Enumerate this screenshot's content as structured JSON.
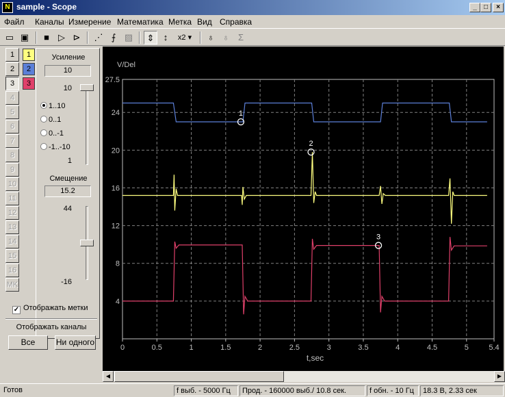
{
  "window": {
    "title": "sample - Scope",
    "min": "_",
    "max": "□",
    "close": "×"
  },
  "menu": [
    "Файл",
    "Каналы",
    "Измерение",
    "Математика",
    "Метка",
    "Вид",
    "Справка"
  ],
  "channels": {
    "buttons": [
      "1",
      "2",
      "3",
      "4",
      "5",
      "6",
      "7",
      "8",
      "9",
      "10",
      "11",
      "12",
      "13",
      "14",
      "15",
      "16",
      "MK"
    ],
    "swatches": [
      {
        "label": "1",
        "color": "#ffff80"
      },
      {
        "label": "2",
        "color": "#5b7fd8"
      },
      {
        "label": "3",
        "color": "#e0406a"
      }
    ]
  },
  "gain": {
    "label": "Усиление",
    "value": "10",
    "slider_top": "10",
    "slider_bottom": "1",
    "slider_level": 0.0,
    "ranges": [
      "1..10",
      "0..1",
      "0..-1",
      "-1..-10"
    ],
    "selected_range": 0
  },
  "offset": {
    "label": "Смещение",
    "value": "15.2",
    "slider_top": "44",
    "slider_bottom": "-16",
    "slider_level": 0.5
  },
  "show_markers": {
    "label": "Отображать метки",
    "checked": true
  },
  "show_channels": {
    "label": "Отображать каналы",
    "all": "Все",
    "none": "Ни одного"
  },
  "status": {
    "ready": "Готов",
    "sample_rate": "f выб. - 5000 Гц",
    "duration": "Прод. - 160000 выб./ 10.8 сек.",
    "refresh": "f обн. - 10 Гц",
    "cursor": "18.3 В,  2.33 сек"
  },
  "chart_data": {
    "type": "line",
    "ylabel": "V/Del",
    "xlabel": "t,sec",
    "xlim": [
      0,
      5.4
    ],
    "ylim": [
      0,
      27.5
    ],
    "x_ticks": [
      "0",
      "0.5",
      "1",
      "1.5",
      "2",
      "2.5",
      "3",
      "3.5",
      "4",
      "4.5",
      "5",
      "5.4"
    ],
    "y_ticks": [
      "4",
      "8",
      "12",
      "16",
      "20",
      "24",
      "27.5"
    ],
    "grid": true,
    "series": [
      {
        "color": "#5b7fd8",
        "points": [
          [
            0,
            25
          ],
          [
            0.74,
            25
          ],
          [
            0.78,
            23
          ],
          [
            1.75,
            23
          ],
          [
            1.78,
            25
          ],
          [
            2.75,
            25
          ],
          [
            2.78,
            23
          ],
          [
            3.75,
            23
          ],
          [
            3.78,
            25
          ],
          [
            4.75,
            25
          ],
          [
            4.78,
            23
          ],
          [
            5.3,
            23
          ]
        ]
      },
      {
        "color": "#ffff80",
        "points": [
          [
            0,
            15.2
          ],
          [
            0.74,
            15.2
          ],
          [
            0.75,
            17.4
          ],
          [
            0.76,
            13.6
          ],
          [
            0.78,
            15.9
          ],
          [
            0.8,
            15.2
          ],
          [
            1.73,
            15.2
          ],
          [
            1.74,
            14.2
          ],
          [
            1.75,
            16.1
          ],
          [
            1.77,
            14.8
          ],
          [
            1.8,
            15.2
          ],
          [
            2.74,
            15.2
          ],
          [
            2.76,
            19.8
          ],
          [
            2.78,
            14.4
          ],
          [
            2.8,
            15.6
          ],
          [
            2.82,
            15.2
          ],
          [
            3.73,
            15.2
          ],
          [
            3.75,
            16.2
          ],
          [
            3.77,
            14.3
          ],
          [
            3.79,
            15.4
          ],
          [
            3.82,
            15.2
          ],
          [
            4.74,
            15.2
          ],
          [
            4.76,
            17
          ],
          [
            4.78,
            12.2
          ],
          [
            4.8,
            15.6
          ],
          [
            4.82,
            15.2
          ],
          [
            5.3,
            15.2
          ]
        ]
      },
      {
        "color": "#e0406a",
        "points": [
          [
            0,
            4
          ],
          [
            0.74,
            4
          ],
          [
            0.76,
            10.3
          ],
          [
            0.78,
            9.6
          ],
          [
            0.82,
            9.95
          ],
          [
            1.74,
            9.95
          ],
          [
            1.76,
            2.6
          ],
          [
            1.78,
            4.5
          ],
          [
            1.82,
            4
          ],
          [
            2.74,
            4
          ],
          [
            2.76,
            10.6
          ],
          [
            2.78,
            9.5
          ],
          [
            2.82,
            9.9
          ],
          [
            3.73,
            9.9
          ],
          [
            3.75,
            2.8
          ],
          [
            3.77,
            4.5
          ],
          [
            3.81,
            4
          ],
          [
            4.74,
            4
          ],
          [
            4.76,
            10.8
          ],
          [
            4.78,
            9.4
          ],
          [
            4.82,
            9.85
          ],
          [
            5.3,
            9.85
          ]
        ]
      }
    ],
    "markers": [
      {
        "label": "1",
        "x": 1.72,
        "y": 23
      },
      {
        "label": "2",
        "x": 2.74,
        "y": 19.8
      },
      {
        "label": "3",
        "x": 3.72,
        "y": 9.9
      }
    ]
  }
}
